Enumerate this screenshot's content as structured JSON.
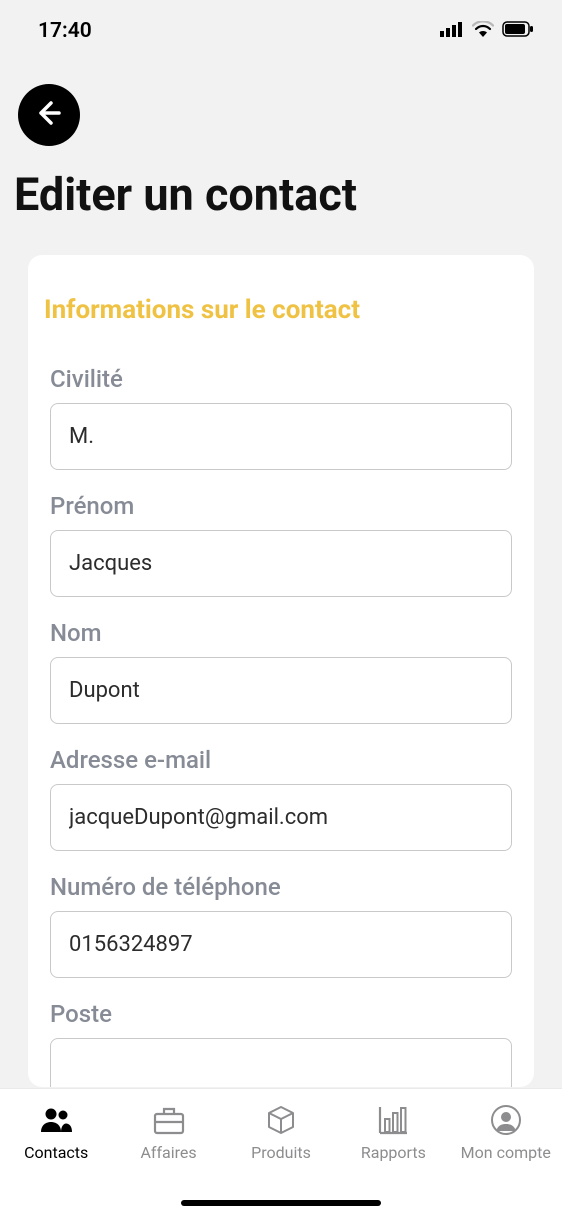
{
  "status": {
    "time": "17:40"
  },
  "page": {
    "title": "Editer un contact"
  },
  "section": {
    "title": "Informations sur le contact"
  },
  "form": {
    "civility": {
      "label": "Civilité",
      "value": "M."
    },
    "firstname": {
      "label": "Prénom",
      "value": "Jacques"
    },
    "lastname": {
      "label": "Nom",
      "value": "Dupont"
    },
    "email": {
      "label": "Adresse e-mail",
      "value": "jacqueDupont@gmail.com"
    },
    "phone": {
      "label": "Numéro de téléphone",
      "value": "0156324897"
    },
    "position": {
      "label": "Poste",
      "value": ""
    }
  },
  "nav": {
    "contacts": "Contacts",
    "affaires": "Affaires",
    "produits": "Produits",
    "rapports": "Rapports",
    "compte": "Mon compte"
  }
}
